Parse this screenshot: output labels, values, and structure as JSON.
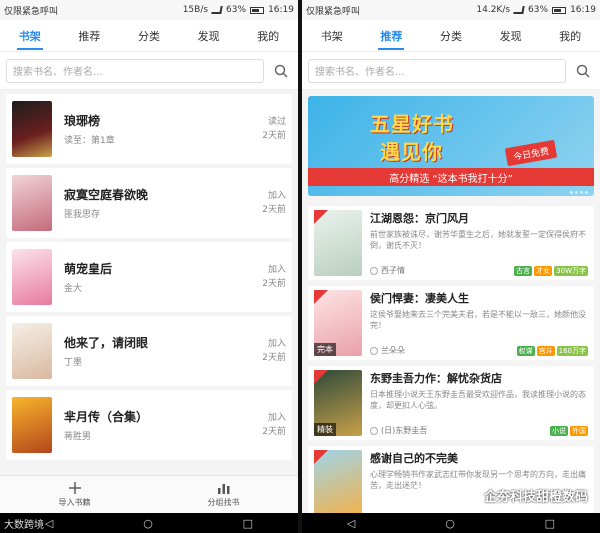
{
  "status_left": {
    "carrier": "仅限紧急呼叫",
    "speed": "15B/s",
    "battery": "63%",
    "time": "16:19"
  },
  "status_right": {
    "carrier": "仅限紧急呼叫",
    "speed": "14.2K/s",
    "battery": "63%",
    "time": "16:19"
  },
  "tabs": [
    "书架",
    "推荐",
    "分类",
    "发现",
    "我的"
  ],
  "search": {
    "placeholder": "搜索书名、作者名..."
  },
  "shelf": [
    {
      "title": "琅琊榜",
      "sub": "读至：第1章",
      "action": "读过",
      "time": "2天前"
    },
    {
      "title": "寂寞空庭春欲晚",
      "sub": "匪我思存",
      "action": "加入",
      "time": "2天前"
    },
    {
      "title": "萌宠皇后",
      "sub": "金大",
      "action": "加入",
      "time": "2天前"
    },
    {
      "title": "他来了，请闭眼",
      "sub": "丁墨",
      "action": "加入",
      "time": "2天前"
    },
    {
      "title": "芈月传（合集）",
      "sub": "蒋胜男",
      "action": "加入",
      "time": "2天前"
    }
  ],
  "bottom_bar": {
    "import": "导入书籍",
    "find": "分组找书"
  },
  "navbar": {
    "brand": "大数跨境"
  },
  "banner": {
    "line1": "五星好书",
    "line2": "遇见你",
    "badge": "今日免费",
    "strip": "高分精选 “这本书我打十分”"
  },
  "recommend": [
    {
      "title": "江湖恩怨：京门风月",
      "desc": "前世家族被诛尽，谢芳华重生之后，她就发誓一定保得侯府不倒，谢氏不灭！",
      "author": "西子情",
      "tags": [
        "古言",
        "才女",
        "30W万字"
      ],
      "flag": ""
    },
    {
      "title": "侯门悍妻：凄美人生",
      "desc": "这侯爷娶她来去三个完美夫君，若是不能以一敌三，她颜他没完！",
      "author": "兰朵朵",
      "tags": [
        "权谋",
        "宫斗",
        "160万字"
      ],
      "flag": "完本"
    },
    {
      "title": "东野圭吾力作：解忧杂货店",
      "desc": "日本推理小说天王东野圭吾最受欢迎作品，我读推理小说的态度，却更扣人心弦。",
      "author": "(日)东野圭吾",
      "tags": [
        "小说",
        "外国"
      ],
      "flag": "精装"
    },
    {
      "title": "感谢自己的不完美",
      "desc": "心理学畅销书作家武志红带你发现另一个思考的方向，走出痛苦，走出迷茫！",
      "author": "",
      "tags": [],
      "flag": ""
    }
  ],
  "watermark": "企夯科技甜橙数码",
  "colors": {
    "accent": "#2a8cf0",
    "red": "#e53935"
  }
}
